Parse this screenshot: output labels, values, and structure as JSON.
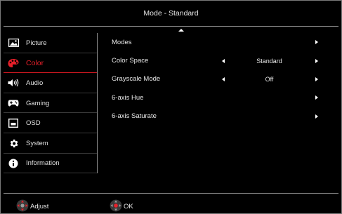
{
  "header": {
    "title": "Mode - Standard"
  },
  "sidebar": {
    "items": [
      {
        "label": "Picture",
        "icon": "picture-icon",
        "active": false
      },
      {
        "label": "Color",
        "icon": "color-palette-icon",
        "active": true
      },
      {
        "label": "Audio",
        "icon": "speaker-icon",
        "active": false
      },
      {
        "label": "Gaming",
        "icon": "gamepad-icon",
        "active": false
      },
      {
        "label": "OSD",
        "icon": "osd-window-icon",
        "active": false
      },
      {
        "label": "System",
        "icon": "gear-icon",
        "active": false
      },
      {
        "label": "Information",
        "icon": "info-icon",
        "active": false
      }
    ]
  },
  "menu": {
    "rows": [
      {
        "label": "Modes",
        "value": ""
      },
      {
        "label": "Color Space",
        "value": "Standard"
      },
      {
        "label": "Grayscale Mode",
        "value": "Off"
      },
      {
        "label": "6-axis Hue",
        "value": ""
      },
      {
        "label": "6-axis Saturate",
        "value": ""
      }
    ]
  },
  "footer": {
    "adjust_label": "Adjust",
    "ok_label": "OK"
  },
  "colors": {
    "accent": "#e8202a",
    "separator": "#8c8c8c",
    "background": "#000000"
  }
}
